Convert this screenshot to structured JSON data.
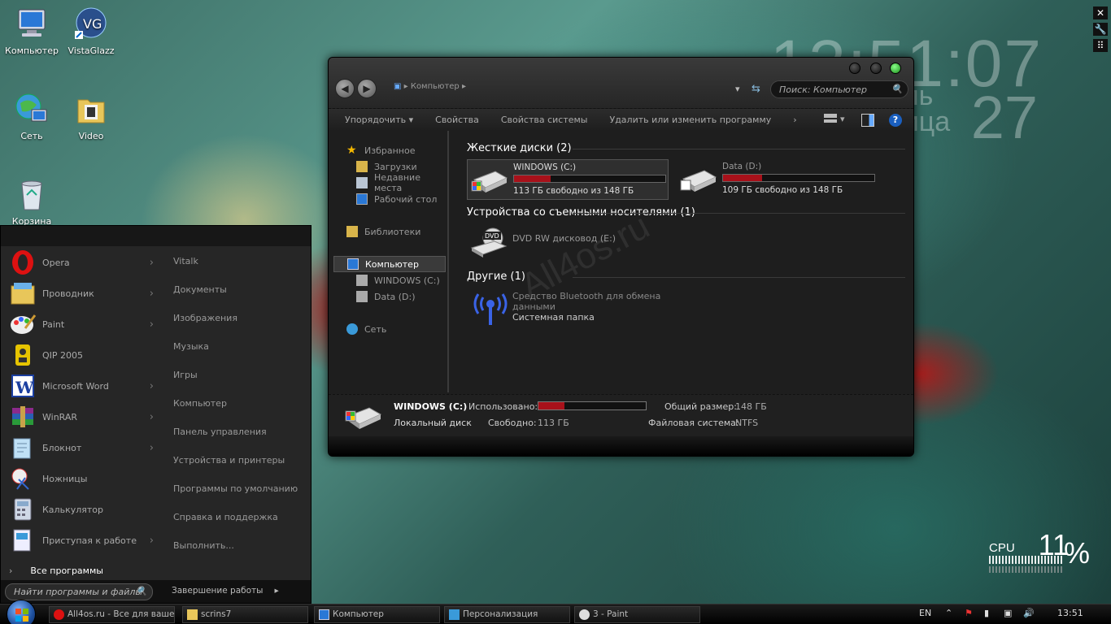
{
  "desktop": {
    "icons": [
      {
        "label": "Компьютер"
      },
      {
        "label": "VistaGlazz"
      },
      {
        "label": "Сеть"
      },
      {
        "label": "Video"
      },
      {
        "label": "Корзина"
      }
    ]
  },
  "clock": {
    "time": "13:51:07",
    "day_line1": "ель",
    "day_line2": "ница",
    "date": "27"
  },
  "explorer": {
    "address": "Компьютер",
    "search_placeholder": "Поиск: Компьютер",
    "toolbar": [
      "Упорядочить",
      "Свойства",
      "Свойства системы",
      "Удалить или изменить программу"
    ],
    "nav": {
      "favorites": "Избранное",
      "downloads": "Загрузки",
      "recent": "Недавние места",
      "desktop": "Рабочий стол",
      "libraries": "Библиотеки",
      "computer": "Компьютер",
      "drive_c": "WINDOWS (C:)",
      "drive_d": "Data (D:)",
      "network": "Сеть"
    },
    "groups": {
      "hdd": "Жесткие диски (2)",
      "removable": "Устройства со съемными носителями (1)",
      "other": "Другие (1)"
    },
    "drives": [
      {
        "name": "WINDOWS (C:)",
        "free": "113 ГБ свободно из 148 ГБ",
        "used_fraction": 0.24
      },
      {
        "name": "Data (D:)",
        "free": "109 ГБ свободно из 148 ГБ",
        "used_fraction": 0.26
      }
    ],
    "dvd": {
      "name": "DVD RW дисковод (E:)",
      "badge": "DVD"
    },
    "bluetooth": {
      "name": "Средство Bluetooth для обмена данными",
      "type": "Системная папка"
    },
    "details": {
      "name": "WINDOWS (C:)",
      "type": "Локальный диск",
      "used_label": "Использовано:",
      "free_label": "Свободно:",
      "free_value": "113 ГБ",
      "total_label": "Общий размер:",
      "total_value": "148 ГБ",
      "fs_label": "Файловая система:",
      "fs_value": "NTFS",
      "used_fraction": 0.24
    }
  },
  "start_menu": {
    "programs": [
      {
        "label": "Opera",
        "arrow": true
      },
      {
        "label": "Проводник",
        "arrow": true
      },
      {
        "label": "Paint",
        "arrow": true
      },
      {
        "label": "QIP 2005",
        "arrow": false
      },
      {
        "label": "Microsoft Word",
        "arrow": true
      },
      {
        "label": "WinRAR",
        "arrow": true
      },
      {
        "label": "Блокнот",
        "arrow": true
      },
      {
        "label": "Ножницы",
        "arrow": false
      },
      {
        "label": "Калькулятор",
        "arrow": false
      },
      {
        "label": "Приступая к работе",
        "arrow": true
      }
    ],
    "all_programs": "Все программы",
    "places": [
      "Vitalk",
      "Документы",
      "Изображения",
      "Музыка",
      "Игры",
      "Компьютер",
      "Панель управления",
      "Устройства и принтеры",
      "Программы по умолчанию",
      "Справка и поддержка",
      "Выполнить..."
    ],
    "search_placeholder": "Найти программы и файлы",
    "shutdown": "Завершение работы"
  },
  "cpu": {
    "label": "CPU",
    "value": "11",
    "sign": "%"
  },
  "taskbar": {
    "tasks": [
      "All4os.ru - Все для ваше...",
      "scrins7",
      "Компьютер",
      "Персонализация",
      "3 - Paint"
    ],
    "lang": "EN",
    "time": "13:51"
  },
  "watermark": "All4os.ru"
}
